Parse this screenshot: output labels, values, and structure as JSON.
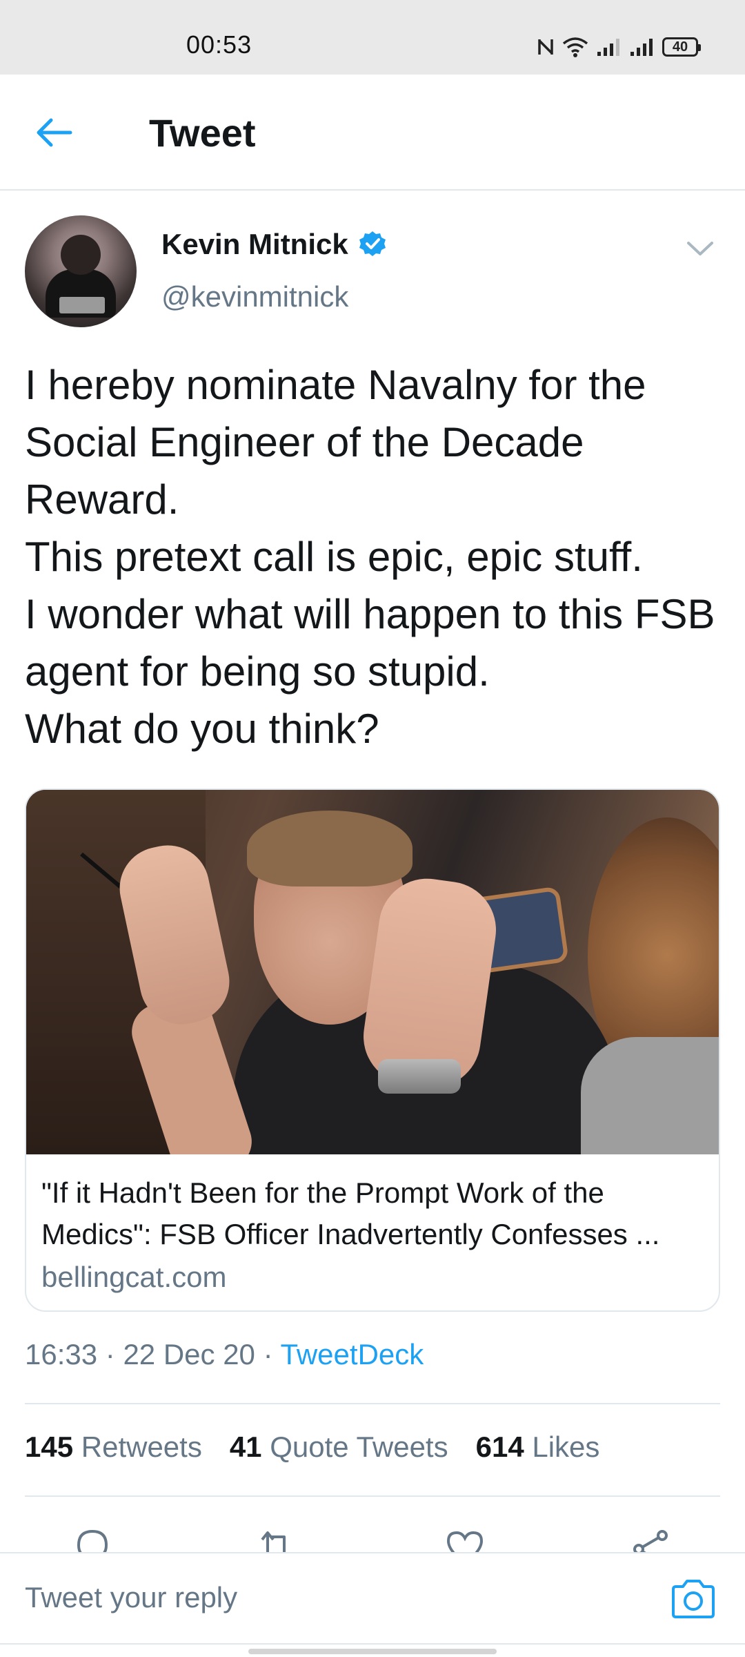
{
  "status_bar": {
    "time": "00:53",
    "battery": "40"
  },
  "header": {
    "title": "Tweet"
  },
  "author": {
    "name": "Kevin Mitnick",
    "handle": "@kevinmitnick"
  },
  "tweet": {
    "text": "I hereby nominate Navalny for the Social Engineer of the Decade Reward.\nThis pretext call is epic, epic stuff.\nI wonder what will happen to this FSB agent for being so stupid.\nWhat do you think?"
  },
  "card": {
    "title": "\"If it Hadn't Been for the Prompt Work of the Medics\": FSB Officer Inadvertently Confesses ...",
    "domain": "bellingcat.com"
  },
  "meta": {
    "time": "16:33",
    "date": "22 Dec 20",
    "separator": "·",
    "source": "TweetDeck"
  },
  "stats": {
    "retweets_count": "145",
    "retweets_label": "Retweets",
    "quotes_count": "41",
    "quotes_label": "Quote Tweets",
    "likes_count": "614",
    "likes_label": "Likes"
  },
  "reply": {
    "placeholder": "Tweet your reply"
  },
  "colors": {
    "accent": "#1da1f2",
    "text": "#14171a",
    "secondary": "#657786",
    "divider": "#e1e8ed"
  },
  "icons": [
    "back-arrow-icon",
    "verified-badge-icon",
    "chevron-down-icon",
    "reply-icon",
    "retweet-icon",
    "like-icon",
    "share-icon",
    "camera-icon",
    "nfc-icon",
    "wifi-icon",
    "signal-icon",
    "battery-icon"
  ]
}
